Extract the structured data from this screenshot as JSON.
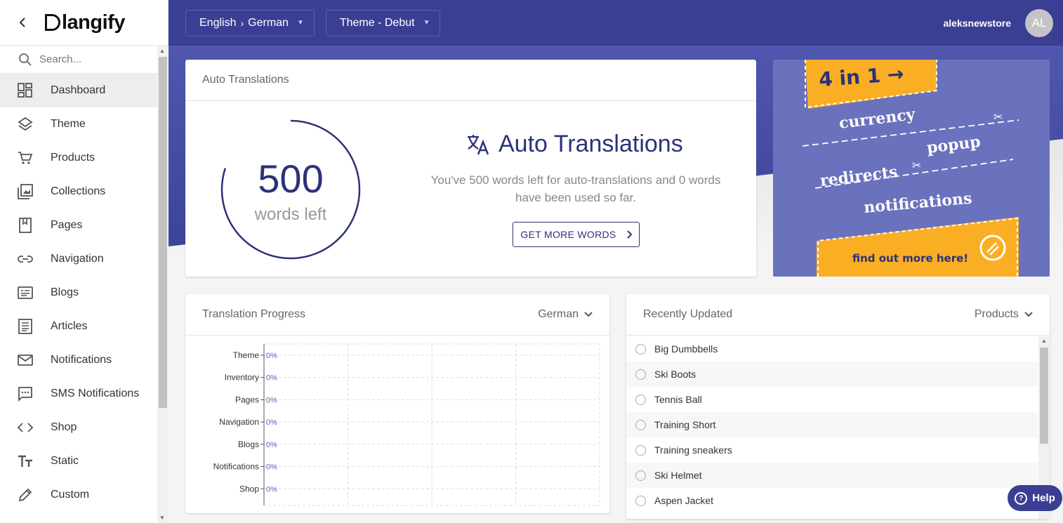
{
  "sidebar": {
    "logo_text": "langify",
    "search_placeholder": "Search...",
    "items": [
      {
        "label": "Dashboard",
        "icon": "dashboard-icon"
      },
      {
        "label": "Theme",
        "icon": "layers-icon"
      },
      {
        "label": "Products",
        "icon": "cart-icon"
      },
      {
        "label": "Collections",
        "icon": "collections-icon"
      },
      {
        "label": "Pages",
        "icon": "pages-icon"
      },
      {
        "label": "Navigation",
        "icon": "link-icon"
      },
      {
        "label": "Blogs",
        "icon": "blogs-icon"
      },
      {
        "label": "Articles",
        "icon": "articles-icon"
      },
      {
        "label": "Notifications",
        "icon": "mail-icon"
      },
      {
        "label": "SMS Notifications",
        "icon": "sms-icon"
      },
      {
        "label": "Shop",
        "icon": "code-icon"
      },
      {
        "label": "Static",
        "icon": "text-size-icon"
      },
      {
        "label": "Custom",
        "icon": "pencil-icon"
      }
    ],
    "active_index": 0
  },
  "topbar": {
    "language_from": "English",
    "language_to": "German",
    "theme_label": "Theme - Debut",
    "store_name": "aleksnewstore",
    "avatar_initials": "AL"
  },
  "auto_translations": {
    "card_title": "Auto Translations",
    "words_left": "500",
    "words_left_label": "words left",
    "words_left_fraction": 0.8,
    "heading": "Auto Translations",
    "description": "You've 500 words left for auto-translations and 0 words have been used so far.",
    "button_label": "GET MORE WORDS"
  },
  "promo": {
    "headline": "4 in 1 →",
    "features": [
      "currency",
      "popup",
      "redirects",
      "notifications"
    ],
    "cta": "find out more here!"
  },
  "translation_progress": {
    "title": "Translation Progress",
    "language": "German"
  },
  "chart_data": {
    "type": "bar",
    "orientation": "horizontal",
    "categories": [
      "Theme",
      "Inventory",
      "Pages",
      "Navigation",
      "Blogs",
      "Notifications",
      "Shop"
    ],
    "values": [
      0,
      0,
      0,
      0,
      0,
      0,
      0
    ],
    "value_labels": [
      "0%",
      "0%",
      "0%",
      "0%",
      "0%",
      "0%",
      "0%"
    ],
    "xlim": [
      0,
      100
    ],
    "grid": true
  },
  "recently_updated": {
    "title": "Recently Updated",
    "filter": "Products",
    "items": [
      "Big Dumbbells",
      "Ski Boots",
      "Tennis Ball",
      "Training Short",
      "Training sneakers",
      "Ski Helmet",
      "Aspen Jacket"
    ]
  },
  "help": {
    "label": "Help"
  },
  "colors": {
    "brand": "#3a3f94",
    "ring": "#2c3278",
    "promo_bg": "#6a72bd",
    "promo_accent": "#f9ae24",
    "chart_value": "#5b64c4"
  }
}
